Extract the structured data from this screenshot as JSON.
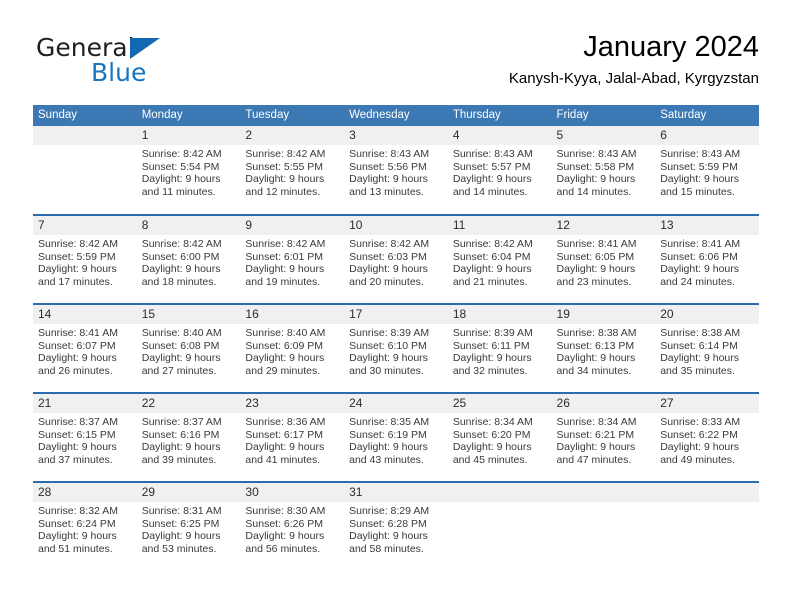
{
  "brand": {
    "name_top": "General",
    "name_bottom": "Blue",
    "color_dark": "#231f20",
    "color_blue": "#1b75bc"
  },
  "header": {
    "title": "January 2024",
    "subtitle": "Kanysh-Kyya, Jalal-Abad, Kyrgyzstan"
  },
  "theme": {
    "header_bar": "#3c78b4",
    "row_rule": "#2b6cb0",
    "daynum_band": "#f0f0f0",
    "text": "#3a3a3a"
  },
  "calendar": {
    "weekday_headers": [
      "Sunday",
      "Monday",
      "Tuesday",
      "Wednesday",
      "Thursday",
      "Friday",
      "Saturday"
    ],
    "weeks": [
      [
        {
          "day": "",
          "empty": true
        },
        {
          "day": "1",
          "sunrise": "Sunrise: 8:42 AM",
          "sunset": "Sunset: 5:54 PM",
          "daylight1": "Daylight: 9 hours",
          "daylight2": "and 11 minutes."
        },
        {
          "day": "2",
          "sunrise": "Sunrise: 8:42 AM",
          "sunset": "Sunset: 5:55 PM",
          "daylight1": "Daylight: 9 hours",
          "daylight2": "and 12 minutes."
        },
        {
          "day": "3",
          "sunrise": "Sunrise: 8:43 AM",
          "sunset": "Sunset: 5:56 PM",
          "daylight1": "Daylight: 9 hours",
          "daylight2": "and 13 minutes."
        },
        {
          "day": "4",
          "sunrise": "Sunrise: 8:43 AM",
          "sunset": "Sunset: 5:57 PM",
          "daylight1": "Daylight: 9 hours",
          "daylight2": "and 14 minutes."
        },
        {
          "day": "5",
          "sunrise": "Sunrise: 8:43 AM",
          "sunset": "Sunset: 5:58 PM",
          "daylight1": "Daylight: 9 hours",
          "daylight2": "and 14 minutes."
        },
        {
          "day": "6",
          "sunrise": "Sunrise: 8:43 AM",
          "sunset": "Sunset: 5:59 PM",
          "daylight1": "Daylight: 9 hours",
          "daylight2": "and 15 minutes."
        }
      ],
      [
        {
          "day": "7",
          "sunrise": "Sunrise: 8:42 AM",
          "sunset": "Sunset: 5:59 PM",
          "daylight1": "Daylight: 9 hours",
          "daylight2": "and 17 minutes."
        },
        {
          "day": "8",
          "sunrise": "Sunrise: 8:42 AM",
          "sunset": "Sunset: 6:00 PM",
          "daylight1": "Daylight: 9 hours",
          "daylight2": "and 18 minutes."
        },
        {
          "day": "9",
          "sunrise": "Sunrise: 8:42 AM",
          "sunset": "Sunset: 6:01 PM",
          "daylight1": "Daylight: 9 hours",
          "daylight2": "and 19 minutes."
        },
        {
          "day": "10",
          "sunrise": "Sunrise: 8:42 AM",
          "sunset": "Sunset: 6:03 PM",
          "daylight1": "Daylight: 9 hours",
          "daylight2": "and 20 minutes."
        },
        {
          "day": "11",
          "sunrise": "Sunrise: 8:42 AM",
          "sunset": "Sunset: 6:04 PM",
          "daylight1": "Daylight: 9 hours",
          "daylight2": "and 21 minutes."
        },
        {
          "day": "12",
          "sunrise": "Sunrise: 8:41 AM",
          "sunset": "Sunset: 6:05 PM",
          "daylight1": "Daylight: 9 hours",
          "daylight2": "and 23 minutes."
        },
        {
          "day": "13",
          "sunrise": "Sunrise: 8:41 AM",
          "sunset": "Sunset: 6:06 PM",
          "daylight1": "Daylight: 9 hours",
          "daylight2": "and 24 minutes."
        }
      ],
      [
        {
          "day": "14",
          "sunrise": "Sunrise: 8:41 AM",
          "sunset": "Sunset: 6:07 PM",
          "daylight1": "Daylight: 9 hours",
          "daylight2": "and 26 minutes."
        },
        {
          "day": "15",
          "sunrise": "Sunrise: 8:40 AM",
          "sunset": "Sunset: 6:08 PM",
          "daylight1": "Daylight: 9 hours",
          "daylight2": "and 27 minutes."
        },
        {
          "day": "16",
          "sunrise": "Sunrise: 8:40 AM",
          "sunset": "Sunset: 6:09 PM",
          "daylight1": "Daylight: 9 hours",
          "daylight2": "and 29 minutes."
        },
        {
          "day": "17",
          "sunrise": "Sunrise: 8:39 AM",
          "sunset": "Sunset: 6:10 PM",
          "daylight1": "Daylight: 9 hours",
          "daylight2": "and 30 minutes."
        },
        {
          "day": "18",
          "sunrise": "Sunrise: 8:39 AM",
          "sunset": "Sunset: 6:11 PM",
          "daylight1": "Daylight: 9 hours",
          "daylight2": "and 32 minutes."
        },
        {
          "day": "19",
          "sunrise": "Sunrise: 8:38 AM",
          "sunset": "Sunset: 6:13 PM",
          "daylight1": "Daylight: 9 hours",
          "daylight2": "and 34 minutes."
        },
        {
          "day": "20",
          "sunrise": "Sunrise: 8:38 AM",
          "sunset": "Sunset: 6:14 PM",
          "daylight1": "Daylight: 9 hours",
          "daylight2": "and 35 minutes."
        }
      ],
      [
        {
          "day": "21",
          "sunrise": "Sunrise: 8:37 AM",
          "sunset": "Sunset: 6:15 PM",
          "daylight1": "Daylight: 9 hours",
          "daylight2": "and 37 minutes."
        },
        {
          "day": "22",
          "sunrise": "Sunrise: 8:37 AM",
          "sunset": "Sunset: 6:16 PM",
          "daylight1": "Daylight: 9 hours",
          "daylight2": "and 39 minutes."
        },
        {
          "day": "23",
          "sunrise": "Sunrise: 8:36 AM",
          "sunset": "Sunset: 6:17 PM",
          "daylight1": "Daylight: 9 hours",
          "daylight2": "and 41 minutes."
        },
        {
          "day": "24",
          "sunrise": "Sunrise: 8:35 AM",
          "sunset": "Sunset: 6:19 PM",
          "daylight1": "Daylight: 9 hours",
          "daylight2": "and 43 minutes."
        },
        {
          "day": "25",
          "sunrise": "Sunrise: 8:34 AM",
          "sunset": "Sunset: 6:20 PM",
          "daylight1": "Daylight: 9 hours",
          "daylight2": "and 45 minutes."
        },
        {
          "day": "26",
          "sunrise": "Sunrise: 8:34 AM",
          "sunset": "Sunset: 6:21 PM",
          "daylight1": "Daylight: 9 hours",
          "daylight2": "and 47 minutes."
        },
        {
          "day": "27",
          "sunrise": "Sunrise: 8:33 AM",
          "sunset": "Sunset: 6:22 PM",
          "daylight1": "Daylight: 9 hours",
          "daylight2": "and 49 minutes."
        }
      ],
      [
        {
          "day": "28",
          "sunrise": "Sunrise: 8:32 AM",
          "sunset": "Sunset: 6:24 PM",
          "daylight1": "Daylight: 9 hours",
          "daylight2": "and 51 minutes."
        },
        {
          "day": "29",
          "sunrise": "Sunrise: 8:31 AM",
          "sunset": "Sunset: 6:25 PM",
          "daylight1": "Daylight: 9 hours",
          "daylight2": "and 53 minutes."
        },
        {
          "day": "30",
          "sunrise": "Sunrise: 8:30 AM",
          "sunset": "Sunset: 6:26 PM",
          "daylight1": "Daylight: 9 hours",
          "daylight2": "and 56 minutes."
        },
        {
          "day": "31",
          "sunrise": "Sunrise: 8:29 AM",
          "sunset": "Sunset: 6:28 PM",
          "daylight1": "Daylight: 9 hours",
          "daylight2": "and 58 minutes."
        },
        {
          "day": "",
          "empty": true
        },
        {
          "day": "",
          "empty": true
        },
        {
          "day": "",
          "empty": true
        }
      ]
    ]
  }
}
